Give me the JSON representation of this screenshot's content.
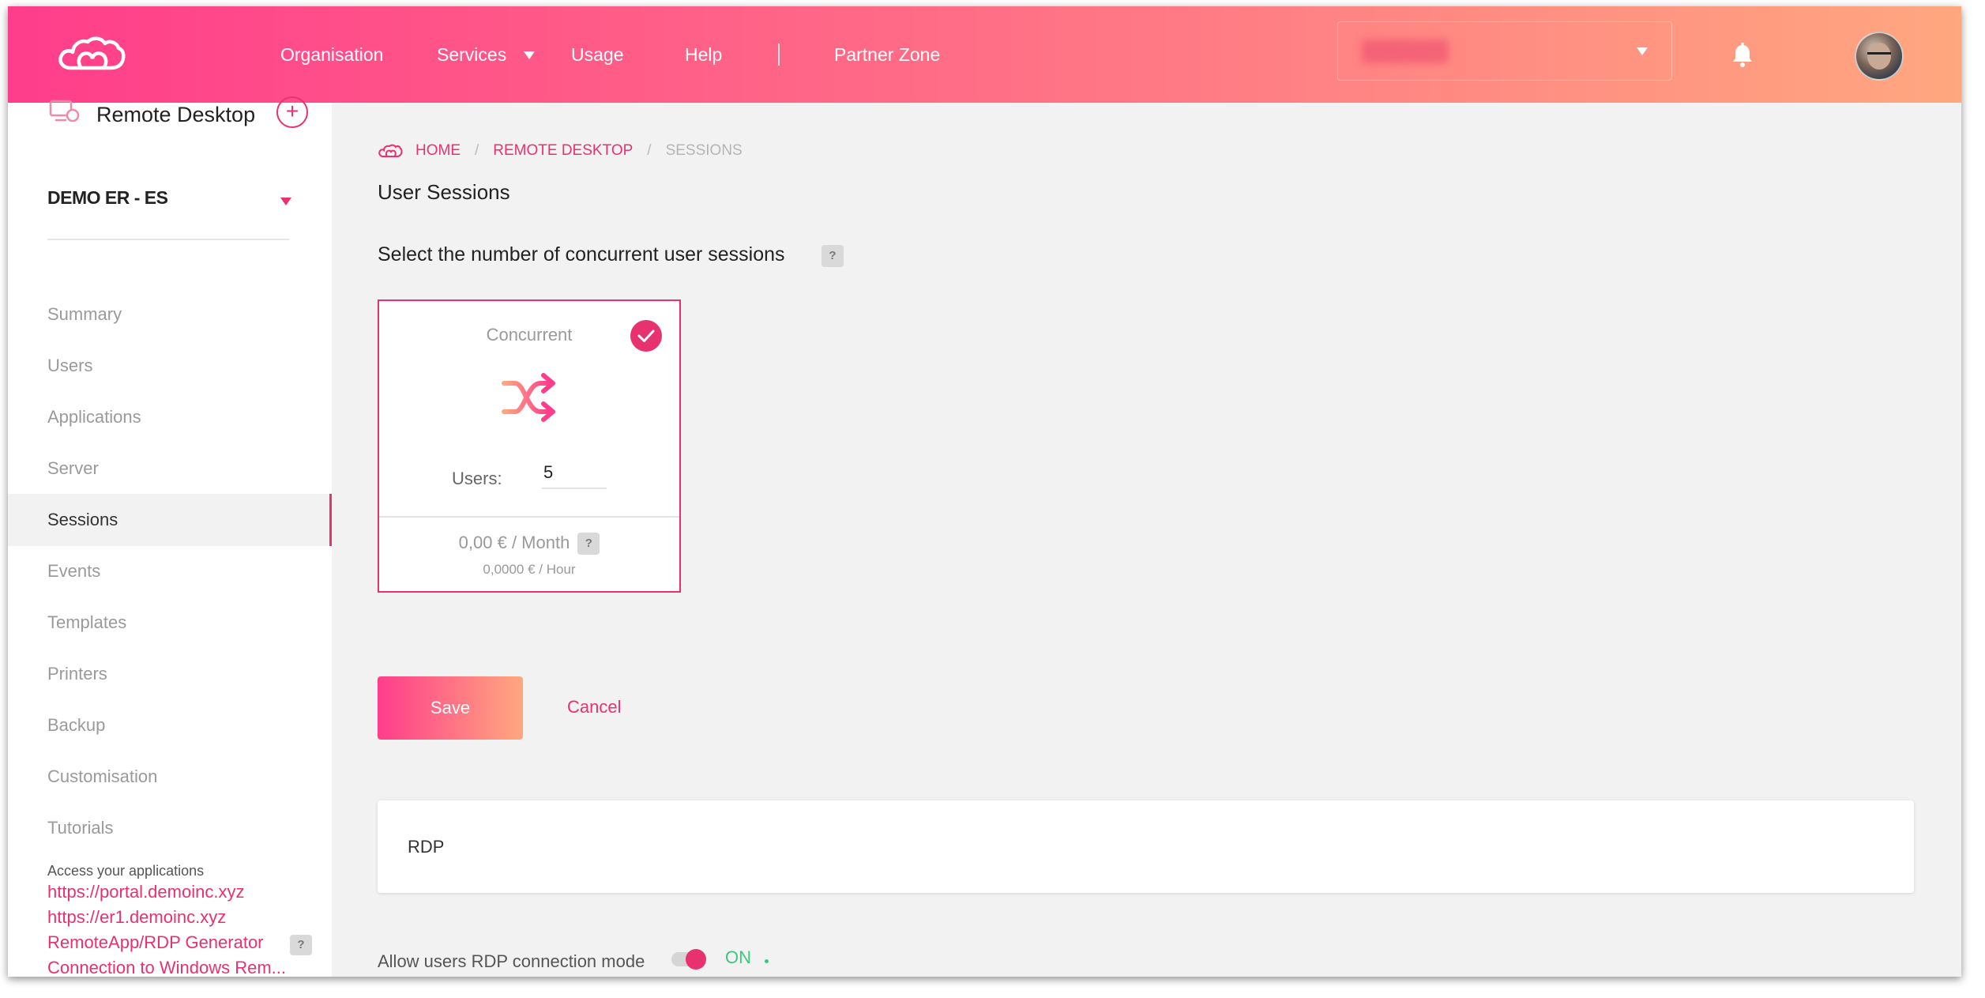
{
  "header": {
    "nav": [
      "Organisation",
      "Services",
      "Usage",
      "Help",
      "Partner Zone"
    ],
    "org_select_value": ""
  },
  "sidebar": {
    "title": "Remote Desktop",
    "plus": "+",
    "org": "DEMO ER - ES",
    "items": [
      {
        "label": "Summary"
      },
      {
        "label": "Users"
      },
      {
        "label": "Applications"
      },
      {
        "label": "Server"
      },
      {
        "label": "Sessions"
      },
      {
        "label": "Events"
      },
      {
        "label": "Templates"
      },
      {
        "label": "Printers"
      },
      {
        "label": "Backup"
      },
      {
        "label": "Customisation"
      },
      {
        "label": "Tutorials"
      }
    ],
    "active_item": "Sessions",
    "access_text": "Access your applications",
    "links": [
      "https://portal.demoinc.xyz",
      "https://er1.demoinc.xyz",
      "RemoteApp/RDP Generator",
      "Connection to Windows Rem..."
    ],
    "help_mark": "?"
  },
  "breadcrumb": {
    "home": "HOME",
    "section": "REMOTE DESKTOP",
    "current": "SESSIONS",
    "separator": "/"
  },
  "main": {
    "page_title": "User Sessions",
    "select_heading": "Select the number of concurrent user sessions",
    "help_mark": "?",
    "card": {
      "title": "Concurrent",
      "users_label": "Users:",
      "users_value": "5",
      "price_month": "0,00 € / Month",
      "price_hour": "0,0000 € / Hour",
      "help_mark": "?",
      "selected": true
    },
    "save_label": "Save",
    "cancel_label": "Cancel",
    "rdp_label": "RDP",
    "allow_label": "Allow users RDP connection mode",
    "toggle_state": "ON"
  },
  "colors": {
    "accent": "#e8326f",
    "gradient_start": "#ff3d8b",
    "gradient_end": "#ffa77f",
    "on_green": "#3cc87a"
  },
  "icons": [
    "cloud-logo-icon",
    "bell-icon",
    "remote-desktop-icon",
    "plus-icon",
    "check-icon",
    "shuffle-icon",
    "help-icon"
  ]
}
